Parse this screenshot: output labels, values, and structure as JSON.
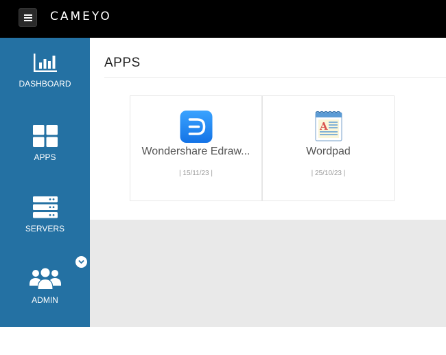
{
  "header": {
    "brand": "CAMEYO"
  },
  "sidebar": {
    "items": [
      {
        "label": "DASHBOARD",
        "icon": "bar-chart-icon"
      },
      {
        "label": "APPS",
        "icon": "grid-icon"
      },
      {
        "label": "SERVERS",
        "icon": "server-icon"
      },
      {
        "label": "ADMIN",
        "icon": "users-icon"
      }
    ]
  },
  "main": {
    "title": "APPS",
    "apps": [
      {
        "name": "Wondershare Edraw...",
        "date": "| 15/11/23 |",
        "icon": "edraw-icon"
      },
      {
        "name": "Wordpad",
        "date": "| 25/10/23 |",
        "icon": "wordpad-icon"
      }
    ]
  },
  "colors": {
    "topbar": "#000000",
    "sidebar": "#2471a3",
    "content_bg": "#e9e9e9",
    "edraw_blue": "#1e88f5"
  }
}
